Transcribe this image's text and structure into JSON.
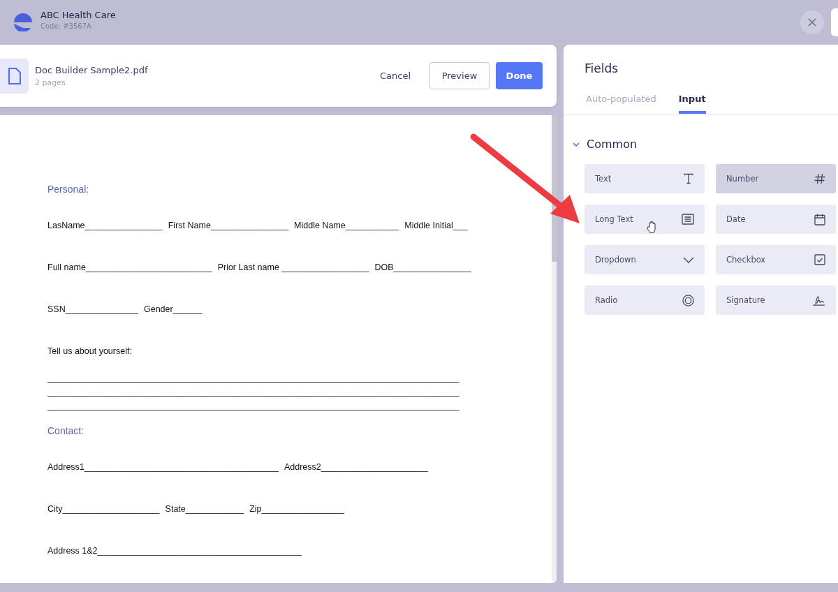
{
  "org": {
    "name": "ABC Health Care",
    "code": "Code: #3567A"
  },
  "file": {
    "name": "Doc Builder Sample2.pdf",
    "pages": "2 pages"
  },
  "actions": {
    "cancel": "Cancel",
    "preview": "Preview",
    "done": "Done"
  },
  "document": {
    "sections": [
      {
        "heading": "Personal:",
        "rows": [
          {
            "kind": "field",
            "texts": [
              "LasName________________",
              "First Name________________",
              "Middle Name___________",
              "Middle Initial___"
            ]
          },
          {
            "kind": "field",
            "texts": [
              "Full name__________________________",
              "Prior Last name __________________",
              "DOB________________"
            ]
          },
          {
            "kind": "field",
            "texts": [
              "SSN_______________",
              "Gender______"
            ]
          },
          {
            "kind": "field",
            "texts": [
              "Tell us about yourself:"
            ]
          },
          {
            "kind": "rule",
            "texts": [
              "______________________________________________________________________________________"
            ]
          },
          {
            "kind": "rule",
            "texts": [
              "______________________________________________________________________________________"
            ]
          },
          {
            "kind": "rule",
            "texts": [
              "______________________________________________________________________________________"
            ]
          }
        ]
      },
      {
        "heading": "Contact:",
        "rows": [
          {
            "kind": "field",
            "texts": [
              "Address1________________________________________",
              "Address2______________________"
            ]
          },
          {
            "kind": "field",
            "texts": [
              "City____________________",
              "State____________",
              "Zip_________________"
            ]
          },
          {
            "kind": "field",
            "texts": [
              "Address 1&2__________________________________________"
            ]
          }
        ]
      }
    ]
  },
  "panel": {
    "title": "Fields",
    "tabs": [
      {
        "label": "Auto-populated",
        "selected": false
      },
      {
        "label": "Input",
        "selected": true
      }
    ],
    "group": {
      "title": "Common",
      "expanded": true,
      "tiles": [
        {
          "label": "Text",
          "selected": false
        },
        {
          "label": "Number",
          "selected": true
        },
        {
          "label": "Long Text",
          "selected": false
        },
        {
          "label": "Date",
          "selected": false
        },
        {
          "label": "Dropdown",
          "selected": false
        },
        {
          "label": "Checkbox",
          "selected": false
        },
        {
          "label": "Radio",
          "selected": false
        },
        {
          "label": "Signature",
          "selected": false
        }
      ]
    }
  }
}
